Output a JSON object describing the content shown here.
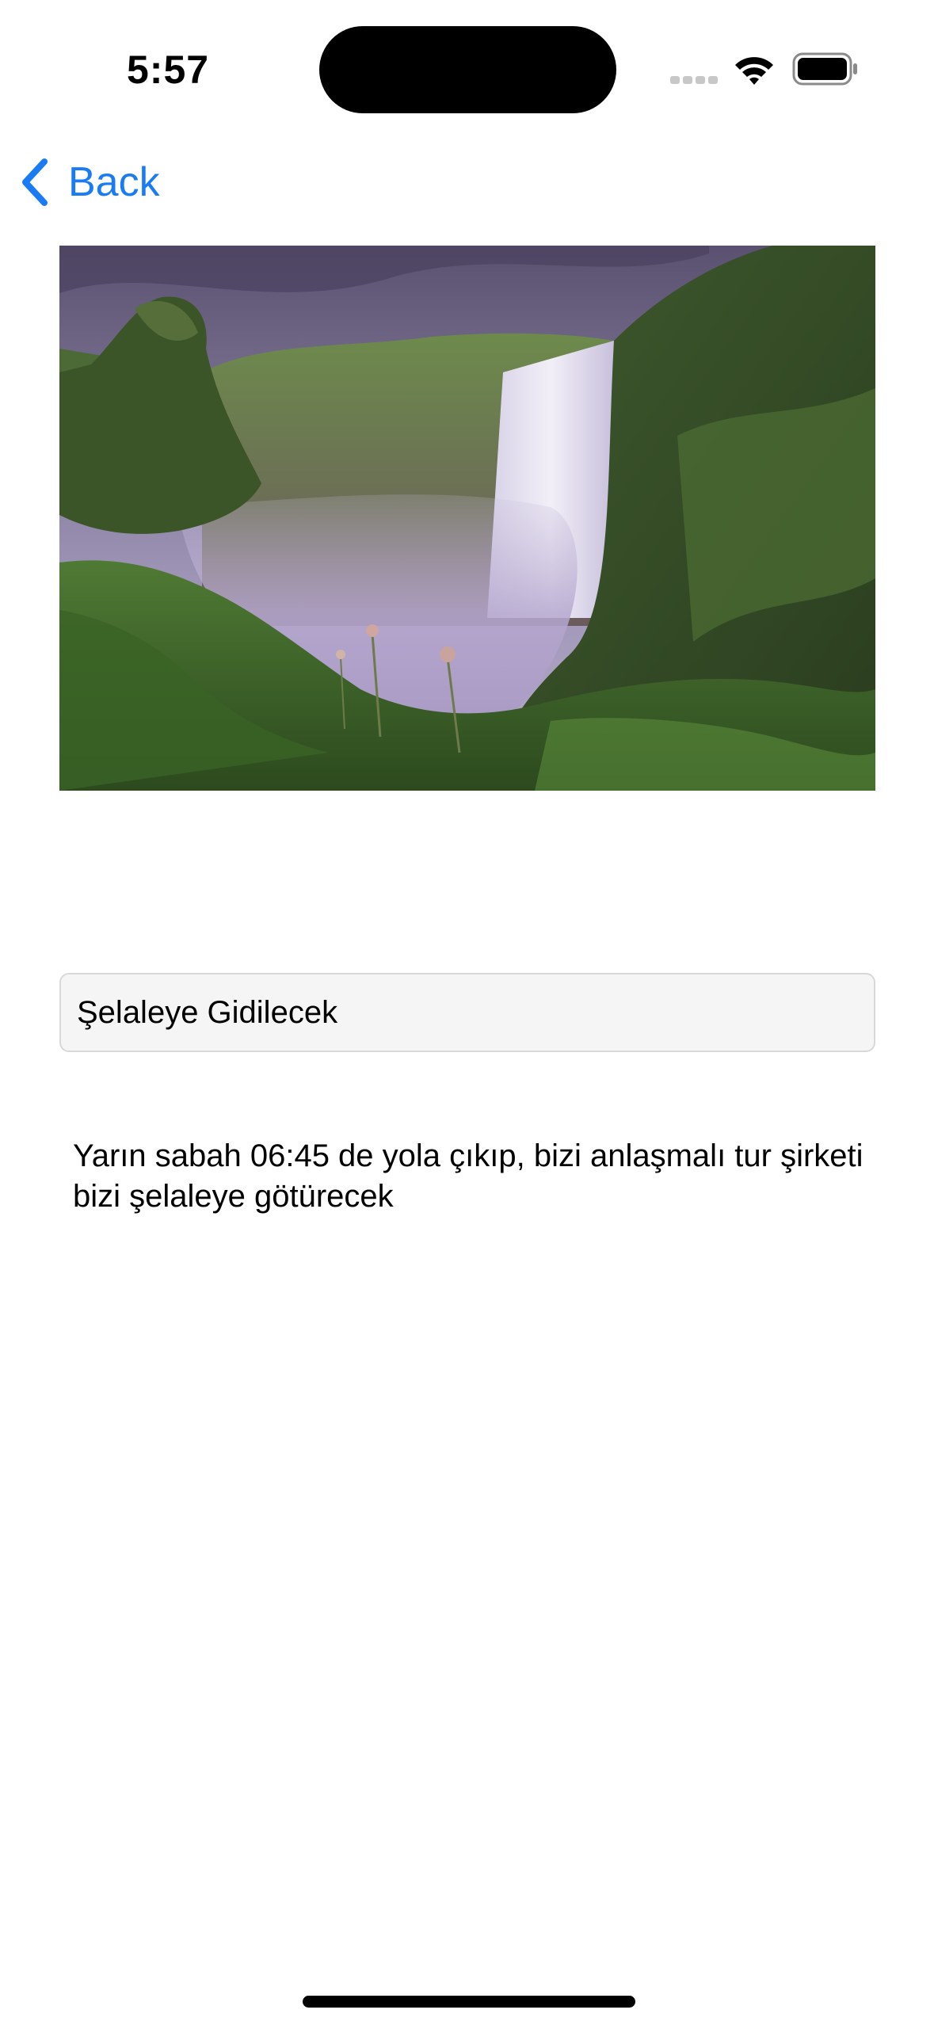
{
  "status_bar": {
    "time": "5:57"
  },
  "nav": {
    "back_label": "Back"
  },
  "photo": {
    "subject": "waterfall"
  },
  "form": {
    "title_value": "Şelaleye Gidilecek",
    "description": "Yarın sabah 06:45 de yola çıkıp, bizi anlaşmalı tur şirketi bizi şelaleye götürecek"
  },
  "colors": {
    "accent": "#1a7cf5",
    "field_background": "#f5f5f5",
    "field_border": "#d8d8d8"
  },
  "icons": {
    "back": "chevron-left-icon",
    "signal": "cellular-signal-icon",
    "wifi": "wifi-icon",
    "battery": "battery-icon"
  }
}
